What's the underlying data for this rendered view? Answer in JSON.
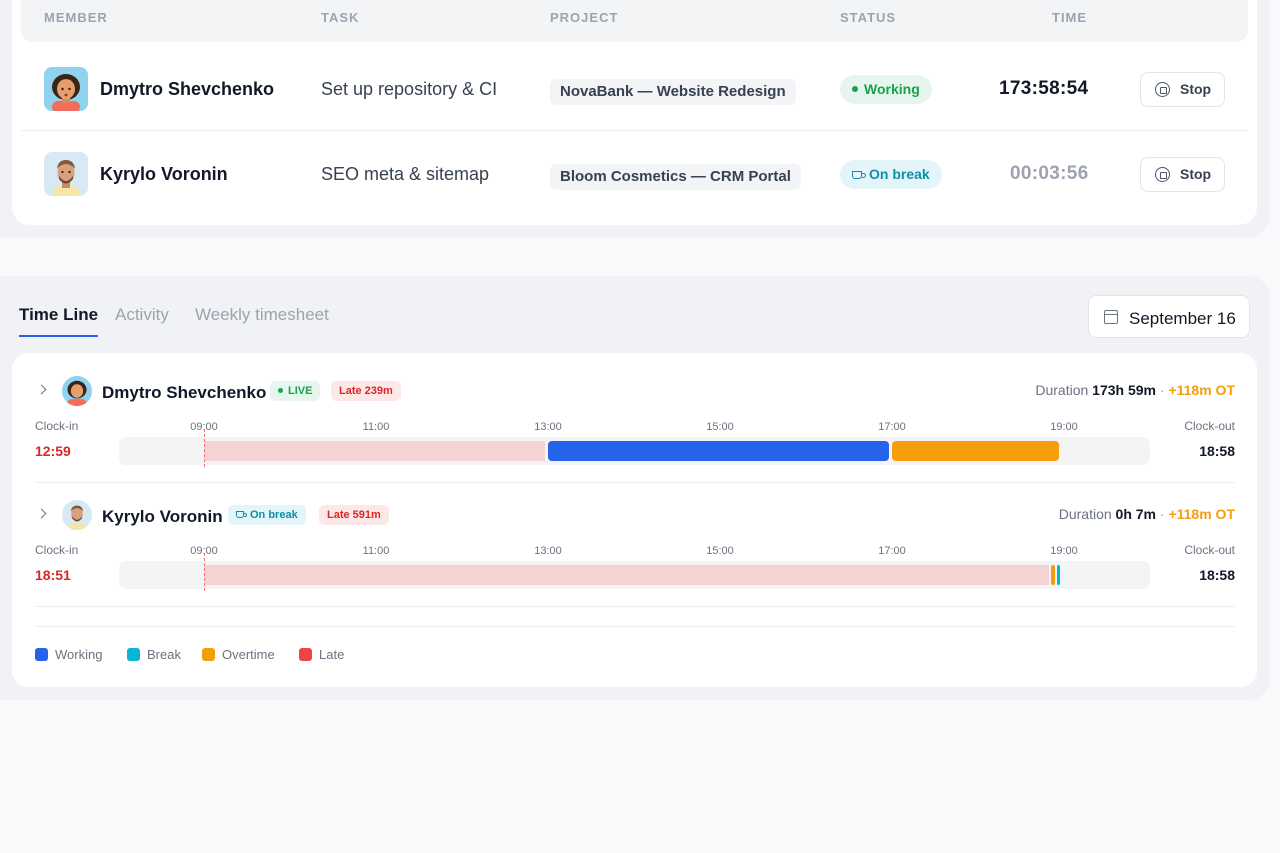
{
  "members_table": {
    "headers": {
      "member": "MEMBER",
      "task": "TASK",
      "project": "PROJECT",
      "status": "STATUS",
      "time": "TIME"
    },
    "rows": [
      {
        "name": "Dmytro Shevchenko",
        "task": "Set up repository & CI",
        "project": "NovaBank — Website Redesign",
        "status": "Working",
        "status_icon": "dot-icon",
        "time": "173:58:54",
        "action": "Stop"
      },
      {
        "name": "Kyrylo Voronin",
        "task": "SEO meta & sitemap",
        "project": "Bloom Cosmetics — CRM Portal",
        "status": "On break",
        "status_icon": "cup-icon",
        "time": "00:03:56",
        "action": "Stop"
      }
    ]
  },
  "tabs": [
    "Time Line",
    "Activity",
    "Weekly timesheet"
  ],
  "active_tab": "Time Line",
  "date_picker": {
    "label": "September 16",
    "icon": "calendar-icon"
  },
  "timeline": {
    "ticks": [
      "09:00",
      "11:00",
      "13:00",
      "15:00",
      "17:00",
      "19:00"
    ],
    "clock_in_label": "Clock-in",
    "clock_out_label": "Clock-out",
    "duration_label": "Duration",
    "rows": [
      {
        "name": "Dmytro Shevchenko",
        "status_badge": "LIVE",
        "late_badge": "Late 239m",
        "duration": "173h 59m",
        "ot": "+118m OT",
        "clock_in": "12:59",
        "clock_out": "18:58",
        "segments": [
          {
            "kind": "late",
            "start": "09:00",
            "end": "12:59"
          },
          {
            "kind": "working",
            "start": "13:00",
            "end": "16:59"
          },
          {
            "kind": "overtime",
            "start": "17:00",
            "end": "18:58"
          }
        ]
      },
      {
        "name": "Kyrylo Voronin",
        "status_badge": "On break",
        "late_badge": "Late 591m",
        "duration": "0h 7m",
        "ot": "+118m OT",
        "clock_in": "18:51",
        "clock_out": "18:58",
        "segments": [
          {
            "kind": "late",
            "start": "09:00",
            "end": "18:51"
          },
          {
            "kind": "overtime",
            "start": "18:51",
            "end": "18:55"
          },
          {
            "kind": "break",
            "start": "18:55",
            "end": "18:58"
          }
        ]
      }
    ]
  },
  "legend": [
    {
      "label": "Working",
      "color": "#2563eb"
    },
    {
      "label": "Break",
      "color": "#06b6d4"
    },
    {
      "label": "Overtime",
      "color": "#f59e0b"
    },
    {
      "label": "Late",
      "color": "#ef4444"
    }
  ],
  "colors": {
    "late_fill": "#f4d3d3",
    "working": "#2563eb",
    "overtime": "#f59e0b",
    "break": "#06b6d4"
  }
}
